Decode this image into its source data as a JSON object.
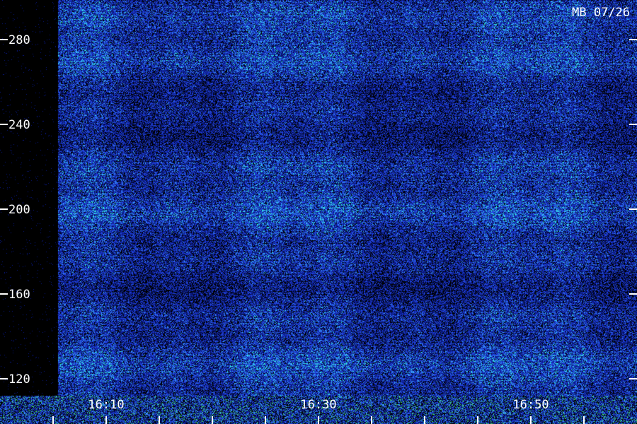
{
  "chart_data": {
    "type": "heatmap",
    "title": "MB 07/26",
    "xlabel": "",
    "ylabel": "",
    "x_ticks": [
      "16:10",
      "16:30",
      "16:50"
    ],
    "y_ticks": [
      120,
      160,
      200,
      240,
      280
    ],
    "ylim": [
      109,
      290
    ],
    "grid": false,
    "legend": "none",
    "colormap": [
      "#000000",
      "#0a1a8a",
      "#2244dd",
      "#3aa0ff",
      "#30f0e0"
    ]
  }
}
